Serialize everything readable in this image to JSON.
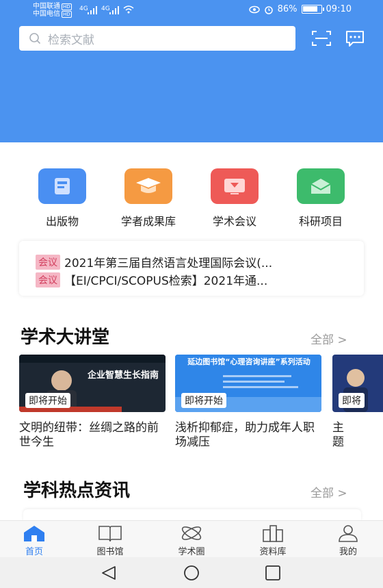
{
  "status_bar": {
    "carrier1": "中国联通",
    "carrier2": "中国电信",
    "hd": "HD",
    "net": "4G",
    "battery": "86%",
    "battery_level": 0.86,
    "time": "09:10"
  },
  "search": {
    "placeholder": "检索文献"
  },
  "categories": [
    {
      "label": "出版物",
      "icon": "publication-icon",
      "color": "#4a8ff2"
    },
    {
      "label": "学者成果库",
      "icon": "graduation-cap-icon",
      "color": "#f59a42"
    },
    {
      "label": "学术会议",
      "icon": "conference-screen-icon",
      "color": "#ee5a57"
    },
    {
      "label": "科研项目",
      "icon": "research-project-icon",
      "color": "#3dbb6c"
    }
  ],
  "notices": [
    {
      "tag": "会议",
      "text": "2021年第三届自然语言处理国际会议(..."
    },
    {
      "tag": "会议",
      "text": "【EI/CPCI/SCOPUS检索】2021年通..."
    }
  ],
  "lectures_section": {
    "title": "学术大讲堂",
    "more": "全部 >"
  },
  "lectures": [
    {
      "badge": "即将开始",
      "title": "文明的纽带：丝绸之路的前世今生",
      "thumb_text": "企业智慧生长指南",
      "color": "#1d2733"
    },
    {
      "badge": "即将开始",
      "title": "浅析抑郁症，助力成年人职场减压",
      "thumb_text": "延边图书馆“心理咨询讲座”系列活动",
      "color": "#2f86e8"
    },
    {
      "badge": "即将",
      "title": "主题节能",
      "thumb_text": "",
      "color": "#233a7a"
    }
  ],
  "news_section": {
    "title": "学科热点资讯",
    "more": "全部 >"
  },
  "tabs": [
    {
      "label": "首页",
      "icon": "home-icon",
      "active": true
    },
    {
      "label": "图书馆",
      "icon": "book-icon",
      "active": false
    },
    {
      "label": "学术圈",
      "icon": "orbit-icon",
      "active": false
    },
    {
      "label": "资料库",
      "icon": "archive-icon",
      "active": false
    },
    {
      "label": "我的",
      "icon": "person-icon",
      "active": false
    }
  ],
  "colors": {
    "accent": "#4b93f0",
    "tab_active": "#2f7ff0",
    "tag_bg": "#f5b7c5",
    "tag_text": "#d2405f"
  }
}
